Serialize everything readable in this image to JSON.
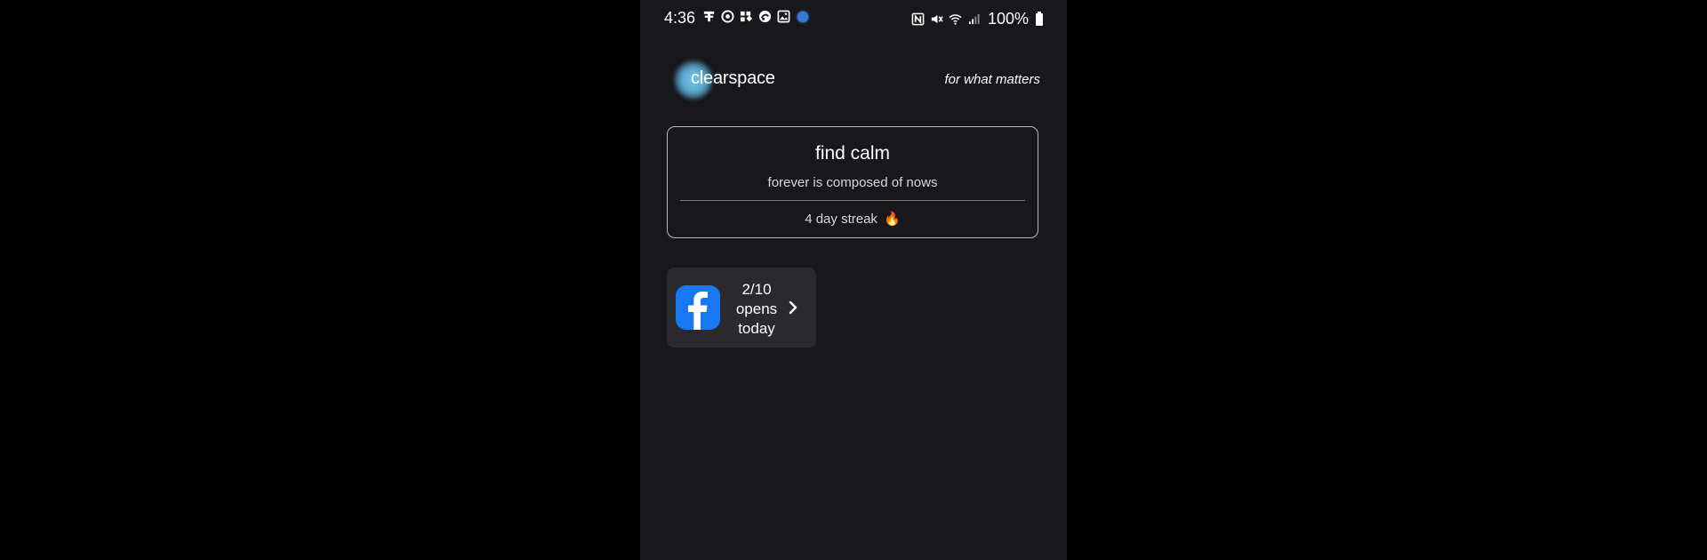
{
  "status_bar": {
    "time": "4:36",
    "battery_percent": "100%",
    "left_icons": [
      "download-icon",
      "target-icon",
      "apps-grid-icon",
      "palette-icon",
      "image-icon",
      "blue-dot-icon"
    ],
    "right_icons": [
      "nfc-icon",
      "mute-icon",
      "wifi-icon",
      "signal-icon",
      "battery-icon"
    ]
  },
  "header": {
    "logo": "clearspace",
    "tagline": "for what matters"
  },
  "card": {
    "title": "find calm",
    "quote": "forever is composed of nows",
    "streak": "4 day streak",
    "streak_icon": "🔥"
  },
  "app_tile": {
    "app_icon": "facebook-icon",
    "count": "2/10",
    "line1": "opens",
    "line2": "today"
  },
  "colors": {
    "background": "#18171b",
    "tile": "#2a292e",
    "facebook_blue": "#1877f2",
    "logo_glow": "#6fb6dd"
  }
}
